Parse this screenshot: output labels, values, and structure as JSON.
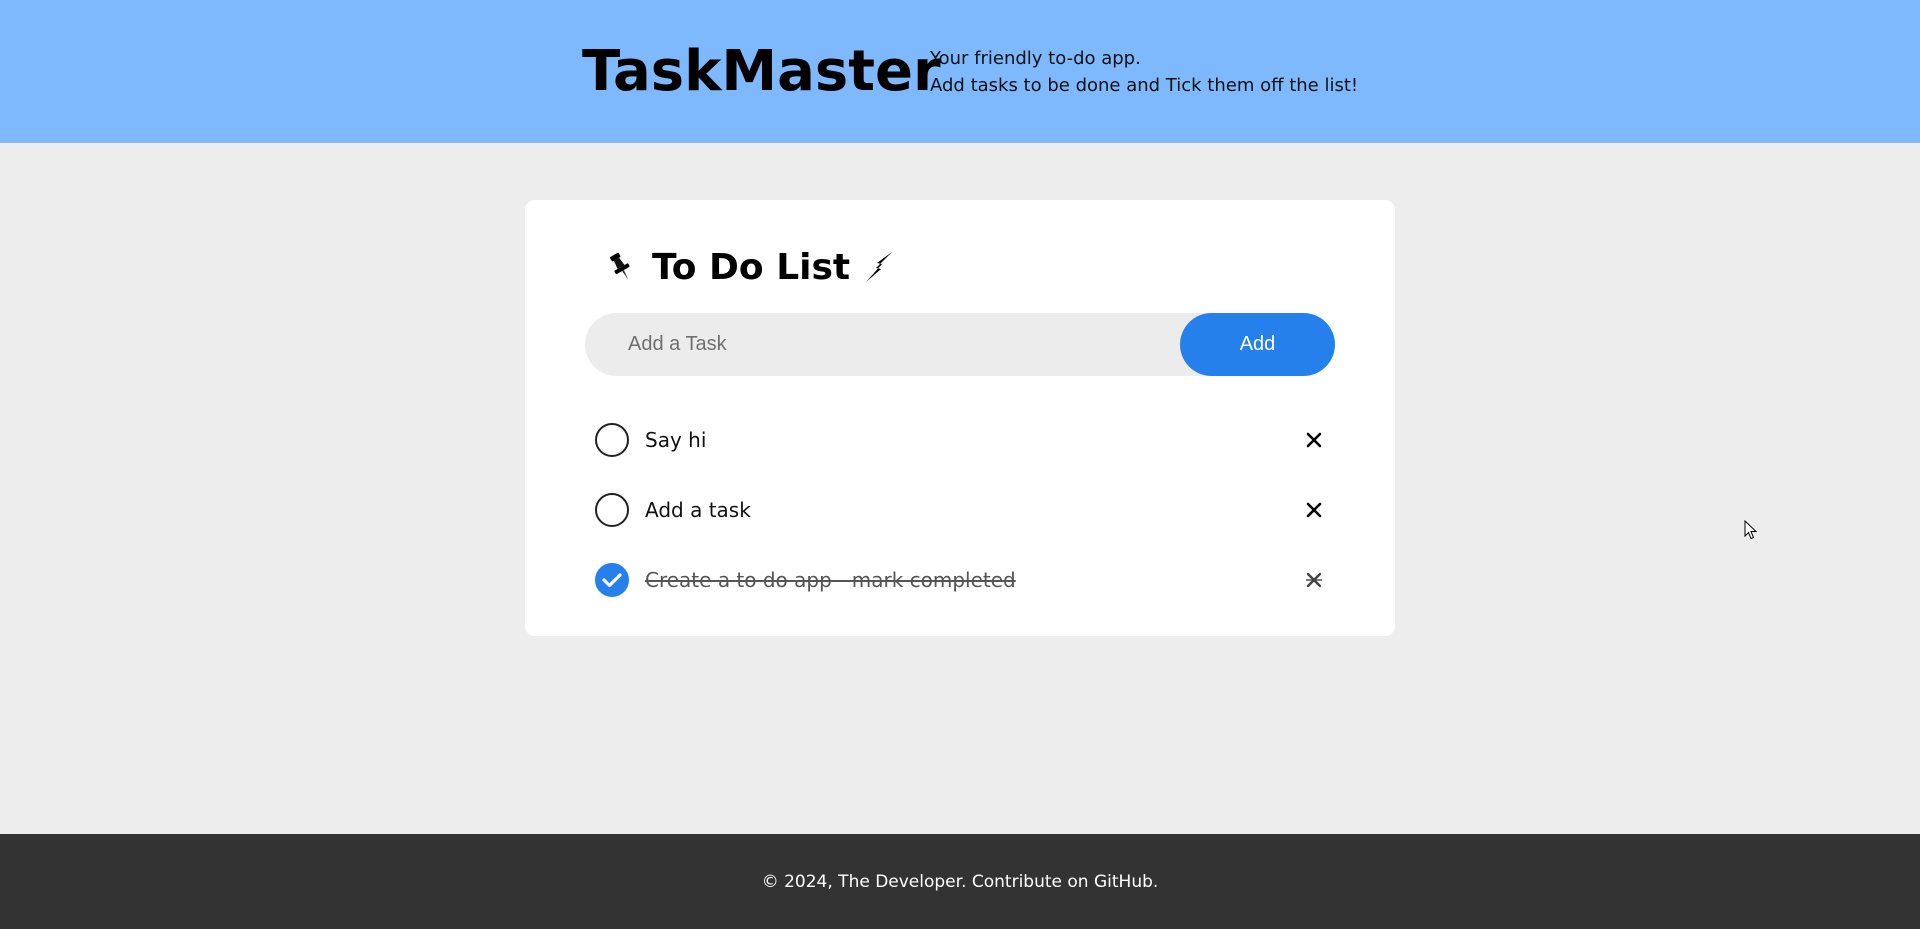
{
  "header": {
    "brand": "TaskMaster",
    "tagline_line1": "Your friendly to-do app.",
    "tagline_line2": "Add tasks to be done and Tick them off the list!",
    "background_color": "#7fb9fd"
  },
  "todo": {
    "title": "To Do List",
    "title_icon_left": "pushpin-icon",
    "title_icon_right": "lightning-icon",
    "input": {
      "placeholder": "Add a Task",
      "value": ""
    },
    "add_label": "Add",
    "accent_color": "#2580ec",
    "tasks": [
      {
        "text": "Say hi",
        "completed": false
      },
      {
        "text": "Add a task",
        "completed": false
      },
      {
        "text": "Create a to do app - mark completed",
        "completed": true
      }
    ]
  },
  "footer": {
    "text": "© 2024, The Developer. Contribute on GitHub."
  }
}
